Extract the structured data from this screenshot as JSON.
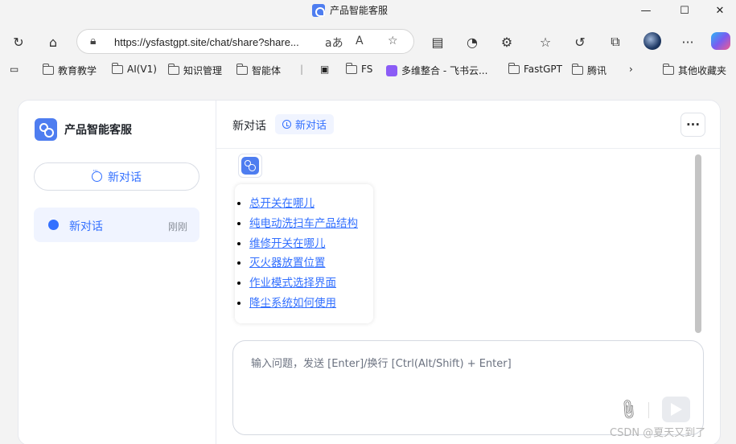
{
  "browser": {
    "window_title": "产品智能客服",
    "url": "https://ysfastgpt.site/chat/share?share...",
    "bookmarks": [
      "教育教学",
      "AI(V1)",
      "知识管理",
      "智能体",
      "FS",
      "多维整合 - 飞书云...",
      "FastGPT",
      "腾讯",
      "其他收藏夹"
    ]
  },
  "sidebar": {
    "brand_name": "产品智能客服",
    "new_chat_label": "新对话",
    "history": [
      {
        "label": "新对话",
        "time": "刚刚"
      }
    ]
  },
  "main": {
    "chat_title": "新对话",
    "tag_label": "新对话",
    "more_label": "···",
    "answer_links": [
      "总开关在哪儿",
      "纯电动洗扫车产品结构",
      "维修开关在哪儿",
      "灭火器放置位置",
      "作业模式选择界面",
      "降尘系统如何使用"
    ],
    "input_placeholder": "输入问题，发送 [Enter]/换行 [Ctrl(Alt/Shift) + Enter]"
  },
  "watermark": "CSDN @夏天又到了",
  "colors": {
    "accent": "#3370ff",
    "brand": "#4e7df0"
  }
}
